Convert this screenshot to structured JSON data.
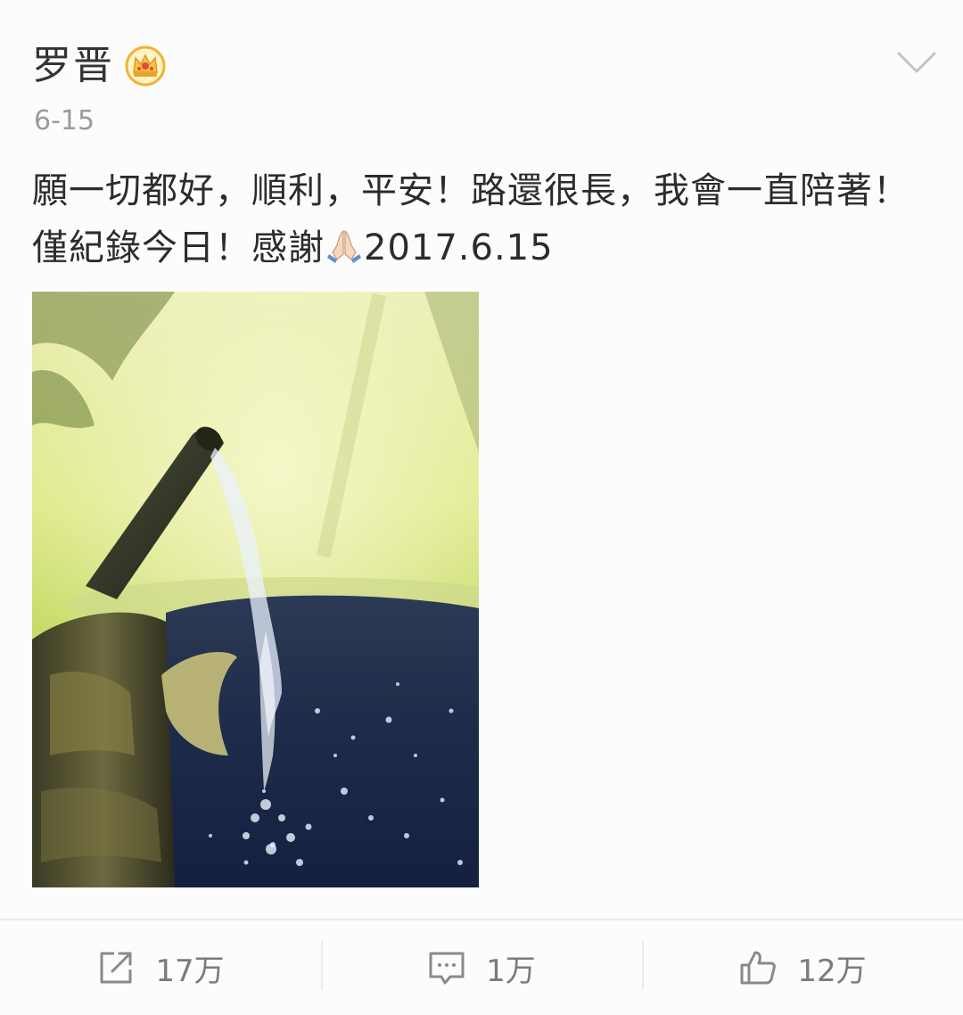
{
  "post": {
    "author": "罗晋",
    "badge_icon": "crown-icon",
    "date": "6-15",
    "text": "願一切都好，順利，平安！路還很長，我會一直陪著！僅紀錄今日！感謝",
    "text_emoji": "praying-hands-emoji",
    "text_suffix": "2017.6.15",
    "photo_icon": "water-spout-photo"
  },
  "menu": {
    "icon": "chevron-down-icon"
  },
  "actions": {
    "repost": {
      "icon": "share-icon",
      "count": "17万"
    },
    "comment": {
      "icon": "comment-icon",
      "count": "1万"
    },
    "like": {
      "icon": "thumbs-up-icon",
      "count": "12万"
    }
  },
  "colors": {
    "background": "#fdfcfd",
    "text": "#2c2c2c",
    "meta": "#9a9a9a",
    "action": "#7b7b7b",
    "badge": "#f2b233"
  }
}
